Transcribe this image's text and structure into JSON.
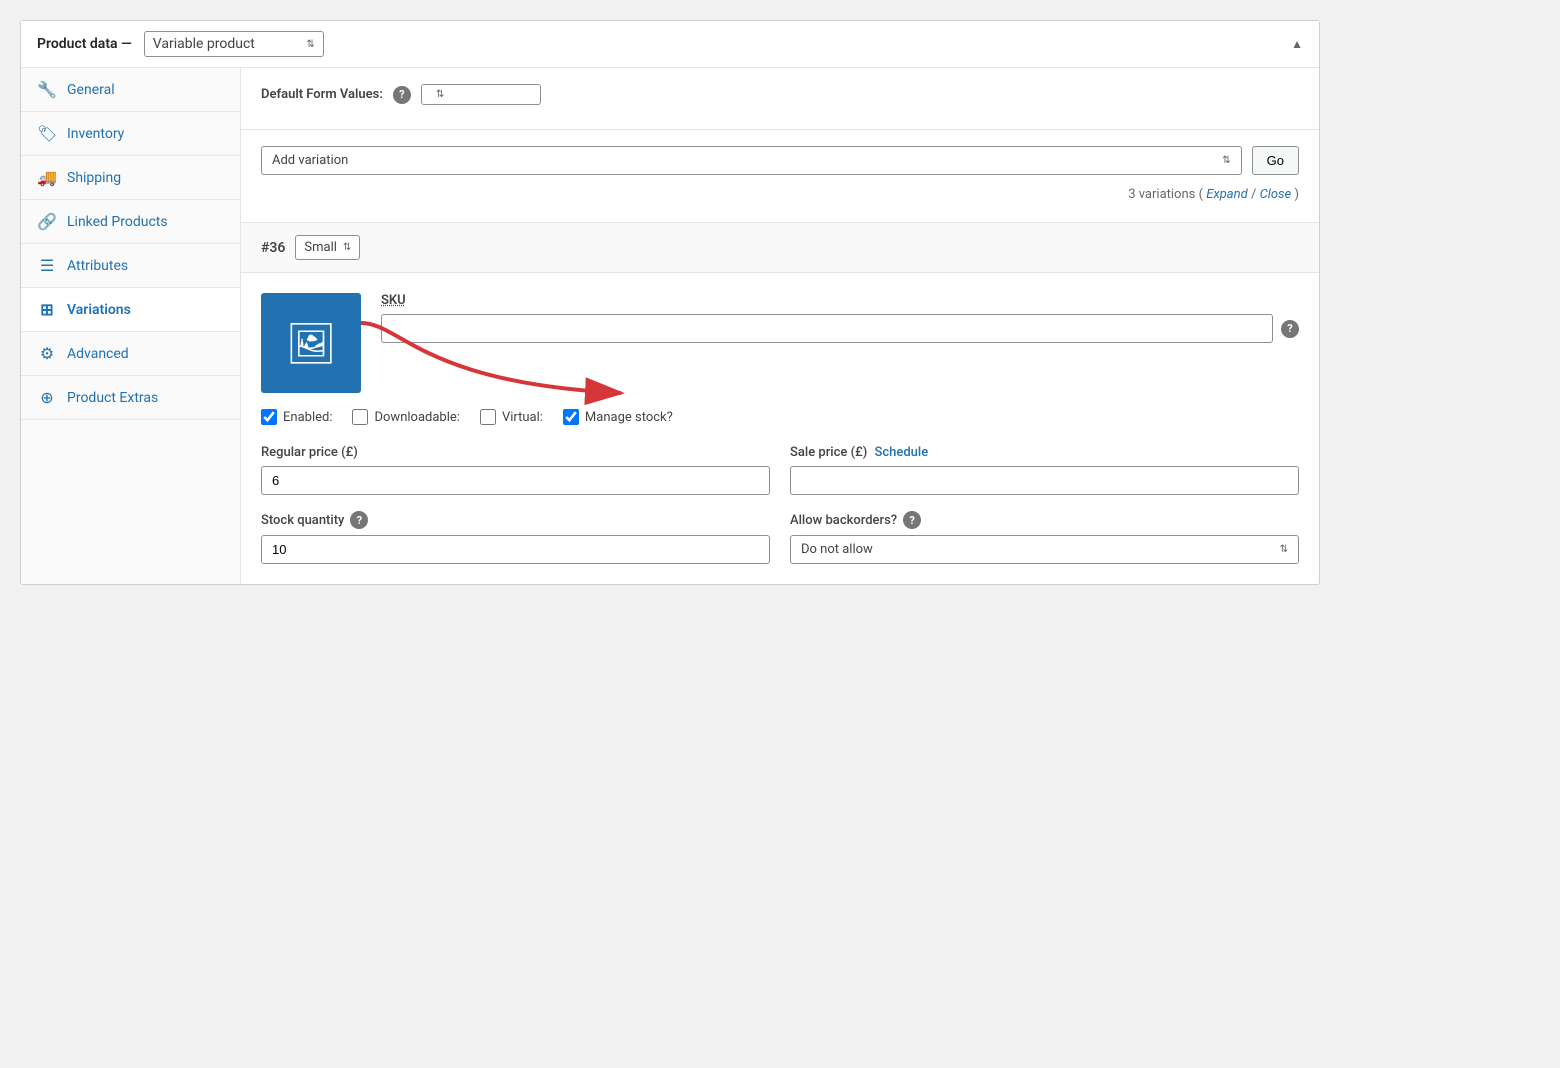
{
  "panel": {
    "title": "Product data —",
    "product_type_label": "Variable product",
    "collapse_icon": "▲"
  },
  "sidebar": {
    "items": [
      {
        "id": "general",
        "label": "General",
        "icon": "🔧"
      },
      {
        "id": "inventory",
        "label": "Inventory",
        "icon": "🏷"
      },
      {
        "id": "shipping",
        "label": "Shipping",
        "icon": "🚚"
      },
      {
        "id": "linked-products",
        "label": "Linked Products",
        "icon": "🔗"
      },
      {
        "id": "attributes",
        "label": "Attributes",
        "icon": "☰"
      },
      {
        "id": "variations",
        "label": "Variations",
        "icon": "⊞",
        "active": true
      },
      {
        "id": "advanced",
        "label": "Advanced",
        "icon": "⚙"
      },
      {
        "id": "product-extras",
        "label": "Product Extras",
        "icon": "⊕"
      }
    ]
  },
  "content": {
    "default_form_values_label": "Default Form Values:",
    "add_variation_option": "Add variation",
    "go_button": "Go",
    "variations_count": "3 variations",
    "expand_link": "Expand",
    "close_link": "Close",
    "variation_number": "#36",
    "variation_size": "Small",
    "sku_label": "SKU",
    "enabled_label": "Enabled:",
    "downloadable_label": "Downloadable:",
    "virtual_label": "Virtual:",
    "manage_stock_label": "Manage stock?",
    "regular_price_label": "Regular price (£)",
    "regular_price_value": "6",
    "sale_price_label": "Sale price (£)",
    "schedule_link": "Schedule",
    "stock_quantity_label": "Stock quantity",
    "stock_quantity_value": "10",
    "allow_backorders_label": "Allow backorders?",
    "backorders_value": "Do not allow"
  },
  "checkboxes": {
    "enabled": true,
    "downloadable": false,
    "virtual": false,
    "manage_stock": true
  }
}
